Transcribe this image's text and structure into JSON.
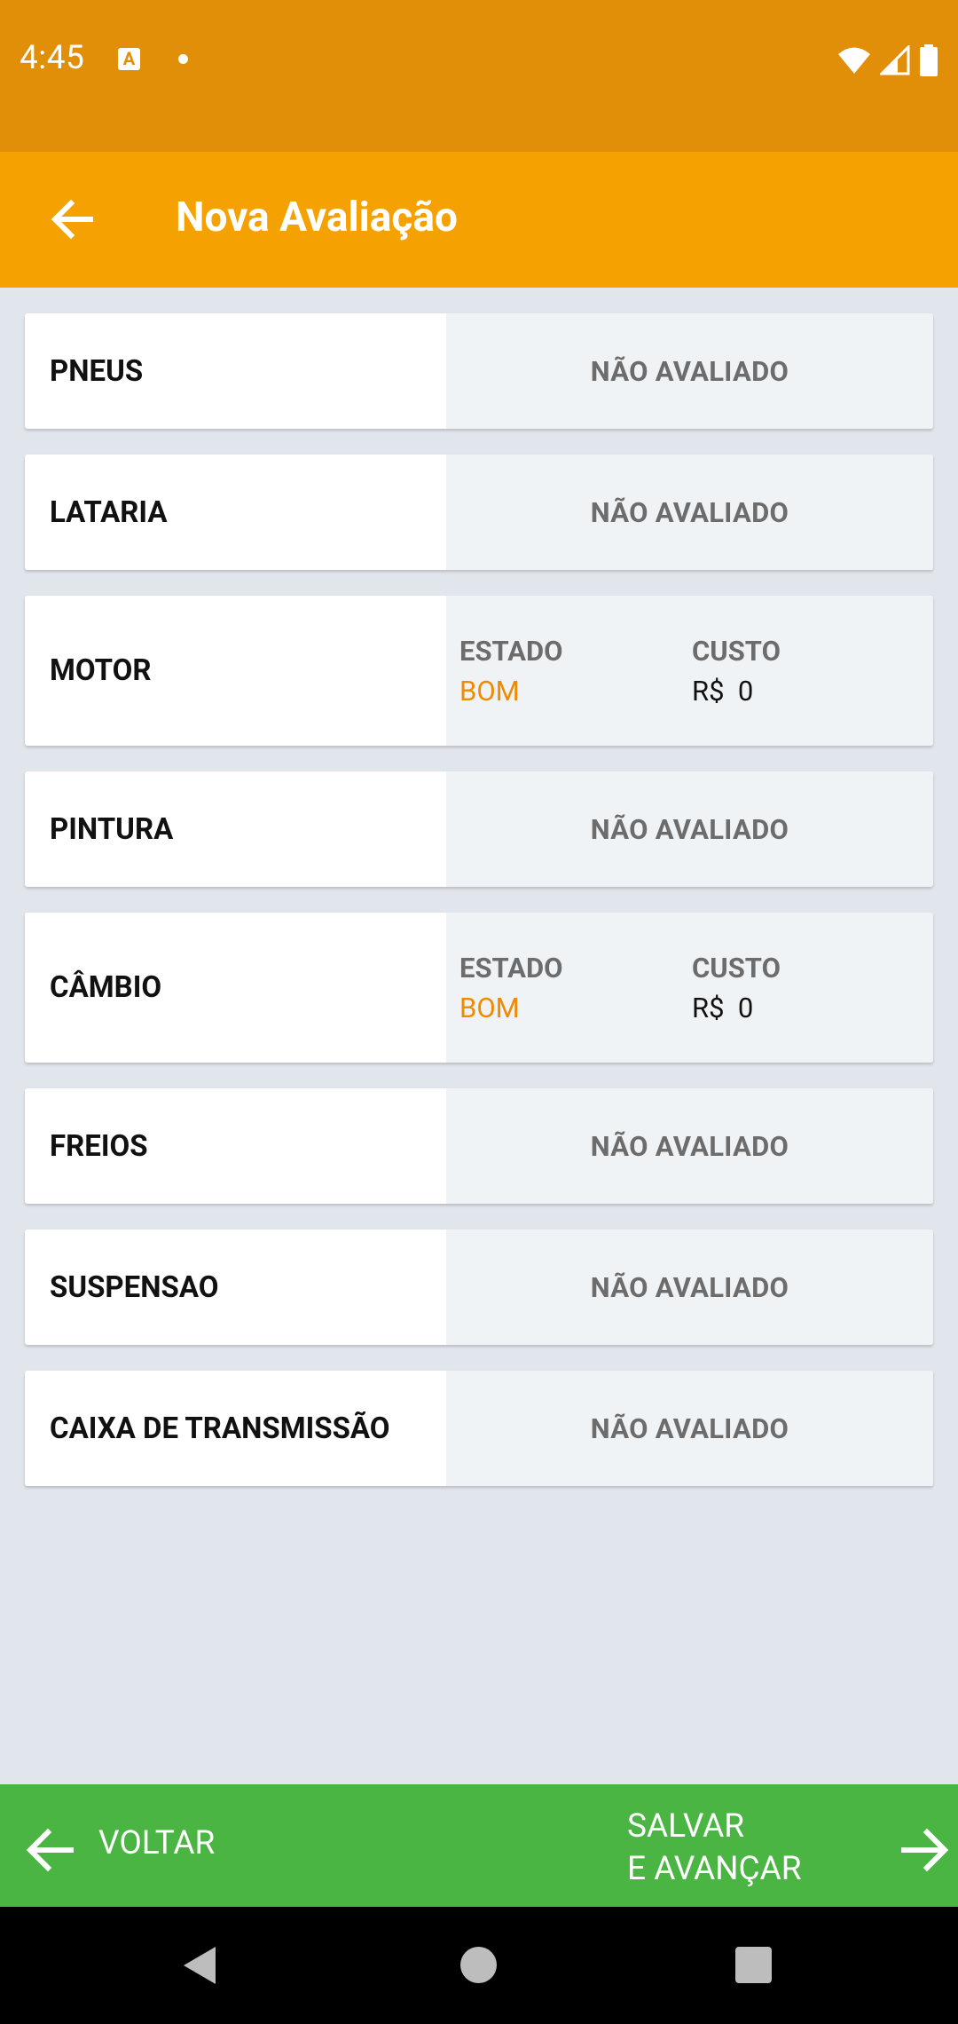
{
  "status_bar": {
    "time": "4:45",
    "app_icon_letter": "A",
    "icons": [
      "notification-app-icon",
      "dot-icon",
      "wifi-icon",
      "cell-signal-icon",
      "battery-icon"
    ]
  },
  "app_bar": {
    "title": "Nova Avaliação",
    "background": "#f5a102"
  },
  "items": [
    {
      "label": "PNEUS",
      "status": "NÃO AVALIADO"
    },
    {
      "label": "LATARIA",
      "status": "NÃO AVALIADO"
    },
    {
      "label": "MOTOR",
      "estado_label": "ESTADO",
      "estado_value": "BOM",
      "custo_label": "CUSTO",
      "custo_value": "R$  0"
    },
    {
      "label": "PINTURA",
      "status": "NÃO AVALIADO"
    },
    {
      "label": "CÂMBIO",
      "estado_label": "ESTADO",
      "estado_value": "BOM",
      "custo_label": "CUSTO",
      "custo_value": "R$  0"
    },
    {
      "label": "FREIOS",
      "status": "NÃO AVALIADO"
    },
    {
      "label": "SUSPENSAO",
      "status": "NÃO AVALIADO"
    },
    {
      "label": "CAIXA DE TRANSMISSÃO",
      "status": "NÃO AVALIADO"
    }
  ],
  "bottom_bar": {
    "back_label": "VOLTAR",
    "next_label_line1": "SALVAR",
    "next_label_line2": "E AVANÇAR",
    "background": "#4bb543"
  },
  "colors": {
    "status_bar": "#e18f08",
    "accent_value": "#f08a00",
    "page_background": "#e1e6ec"
  }
}
